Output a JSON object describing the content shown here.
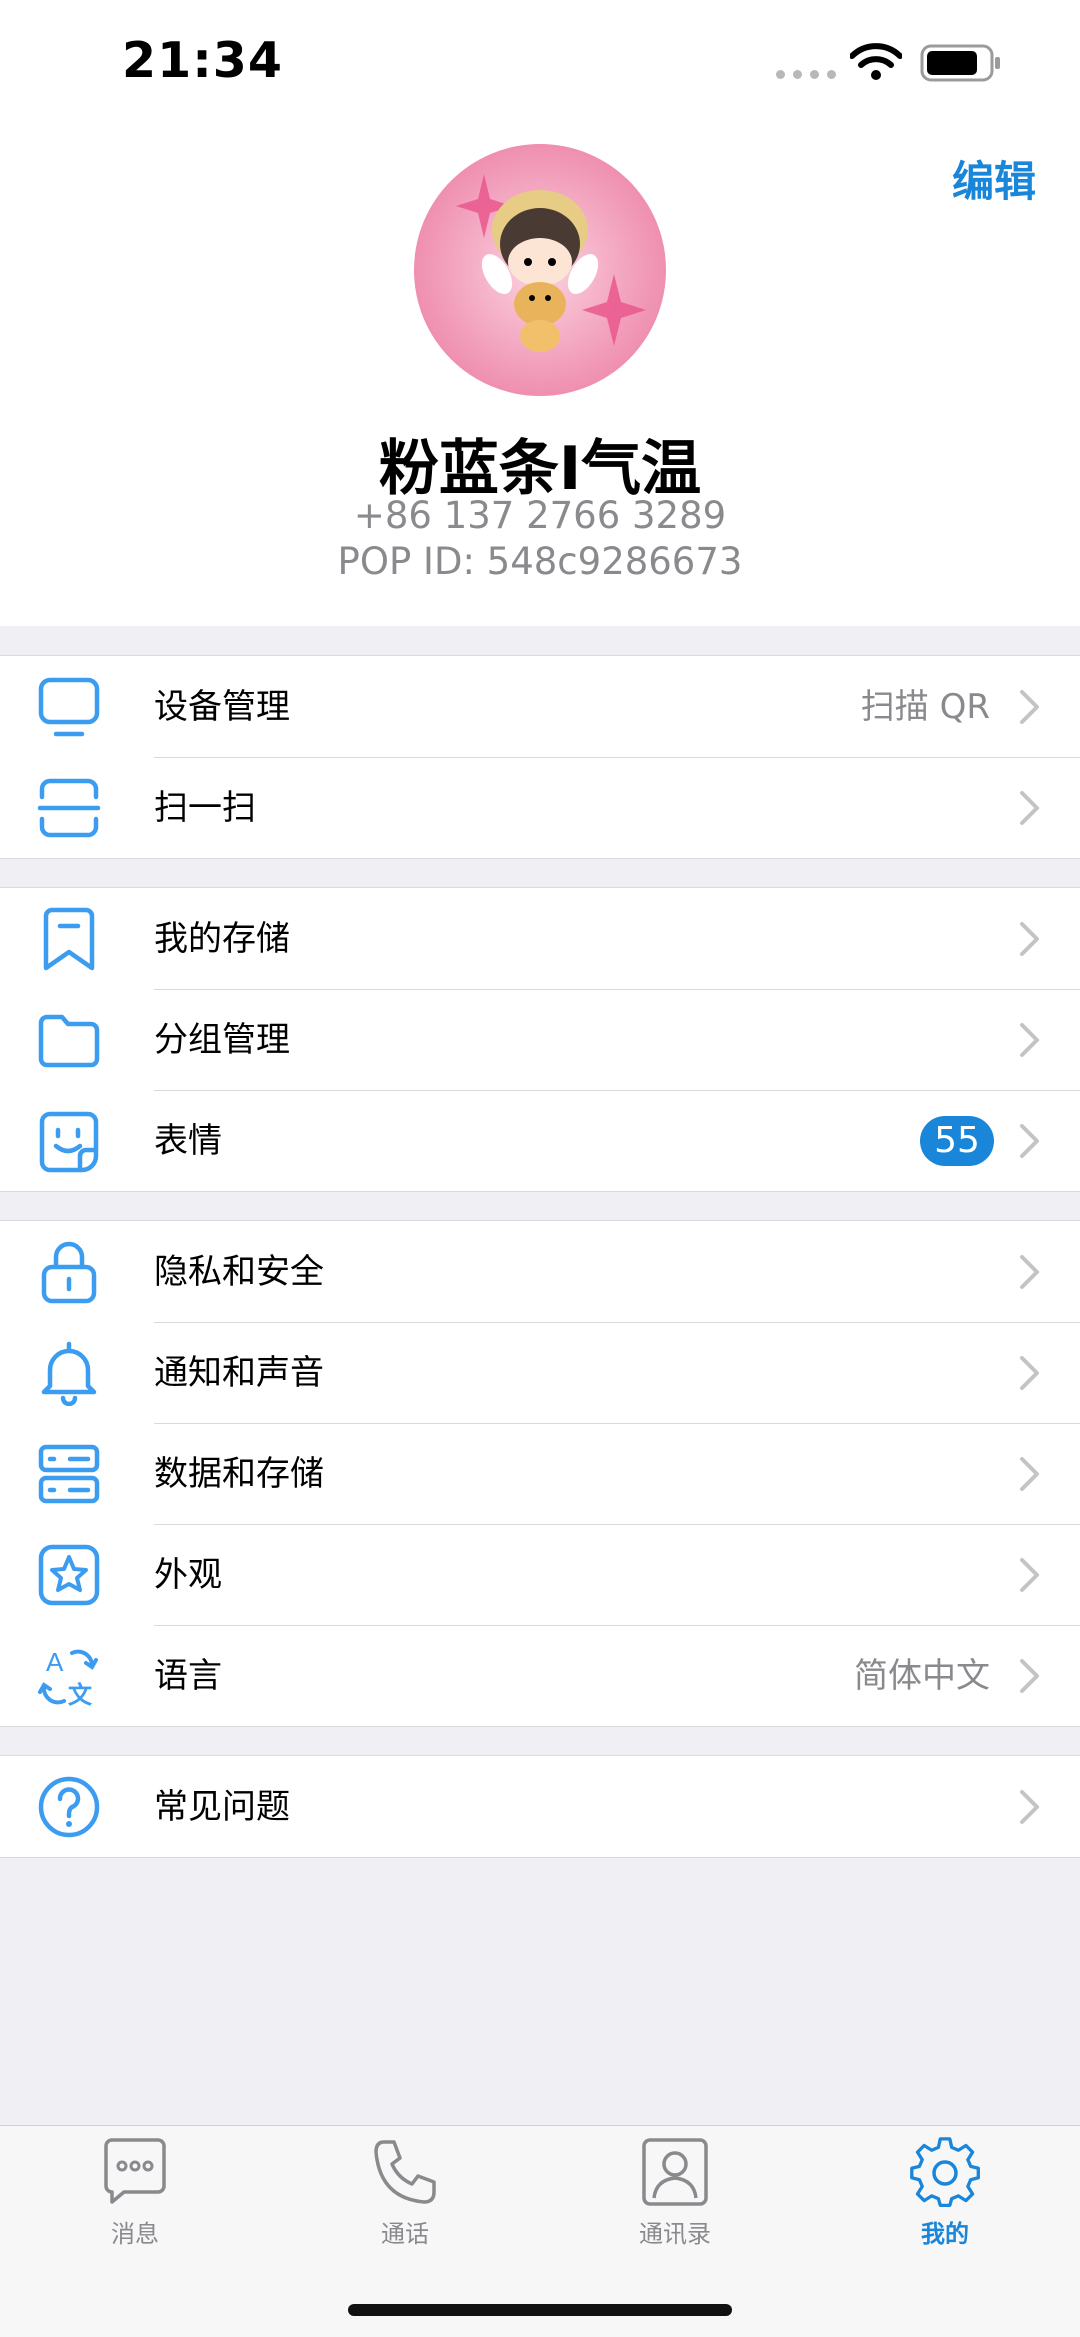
{
  "status_bar": {
    "time": "21:34"
  },
  "header": {
    "edit_label": "编辑"
  },
  "profile": {
    "name": "粉蓝条I气温",
    "phone": "+86 137 2766 3289",
    "pop_id": "POP ID: 548c9286673"
  },
  "groups": [
    {
      "items": [
        {
          "label": "设备管理",
          "value": "扫描 QR",
          "icon": "monitor-icon"
        },
        {
          "label": "扫一扫",
          "icon": "scan-icon"
        }
      ]
    },
    {
      "items": [
        {
          "label": "我的存储",
          "icon": "bookmark-icon"
        },
        {
          "label": "分组管理",
          "icon": "folder-icon"
        },
        {
          "label": "表情",
          "badge": "55",
          "icon": "sticker-icon"
        }
      ]
    },
    {
      "items": [
        {
          "label": "隐私和安全",
          "icon": "lock-icon"
        },
        {
          "label": "通知和声音",
          "icon": "bell-icon"
        },
        {
          "label": "数据和存储",
          "icon": "server-icon"
        },
        {
          "label": "外观",
          "icon": "star-icon"
        },
        {
          "label": "语言",
          "value": "简体中文",
          "icon": "translate-icon"
        }
      ]
    },
    {
      "items": [
        {
          "label": "常见问题",
          "icon": "help-icon"
        }
      ]
    }
  ],
  "tabbar": {
    "tabs": [
      {
        "label": "消息",
        "icon": "chat-icon",
        "active": false
      },
      {
        "label": "通话",
        "icon": "phone-icon",
        "active": false
      },
      {
        "label": "通讯录",
        "icon": "contacts-icon",
        "active": false
      },
      {
        "label": "我的",
        "icon": "gear-icon",
        "active": true
      }
    ]
  },
  "colors": {
    "accent": "#1a86d9",
    "icon_blue": "#3b9cf0",
    "secondary_text": "#8a8a8e",
    "background": "#efeff4"
  }
}
